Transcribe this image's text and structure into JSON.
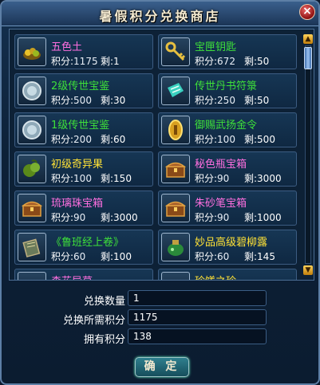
{
  "window": {
    "title": "暑假积分兑换商店",
    "close_glyph": "×"
  },
  "labels": {
    "points": "积分:",
    "remaining": "剩:"
  },
  "colors": {
    "green_name": "#3ee03a",
    "pink_name": "#ff6fe0",
    "yellow_name": "#ffe236"
  },
  "items": [
    {
      "name": "五色土",
      "color": "pink",
      "points": "1175",
      "remaining": "1",
      "icon": "five-color-soil-icon"
    },
    {
      "name": "宝匣钥匙",
      "color": "green",
      "points": "672",
      "remaining": "50",
      "icon": "treasure-key-icon"
    },
    {
      "name": "2级传世宝鉴",
      "color": "green",
      "points": "500",
      "remaining": "30",
      "icon": "mirror-icon"
    },
    {
      "name": "传世丹书符箓",
      "color": "green",
      "points": "250",
      "remaining": "50",
      "icon": "talisman-scroll-icon"
    },
    {
      "name": "1级传世宝鉴",
      "color": "green",
      "points": "200",
      "remaining": "60",
      "icon": "mirror-icon"
    },
    {
      "name": "御赐武扬金令",
      "color": "green",
      "points": "100",
      "remaining": "500",
      "icon": "gold-token-icon"
    },
    {
      "name": "初级奇异果",
      "color": "yellow",
      "points": "100",
      "remaining": "150",
      "icon": "fruit-icon"
    },
    {
      "name": "秘色瓶宝箱",
      "color": "pink",
      "points": "90",
      "remaining": "3000",
      "icon": "treasure-chest-icon"
    },
    {
      "name": "琉璃珠宝箱",
      "color": "pink",
      "points": "90",
      "remaining": "3000",
      "icon": "treasure-chest-icon"
    },
    {
      "name": "朱砂笔宝箱",
      "color": "pink",
      "points": "90",
      "remaining": "1000",
      "icon": "treasure-chest-icon"
    },
    {
      "name": "《鲁班经上卷》",
      "color": "green",
      "points": "60",
      "remaining": "100",
      "icon": "book-icon"
    },
    {
      "name": "妙品高级碧柳露",
      "color": "yellow",
      "points": "60",
      "remaining": "145",
      "icon": "potion-jar-icon"
    },
    {
      "name": "森花异草",
      "color": "pink",
      "points": "",
      "remaining": "",
      "icon": "herb-icon"
    },
    {
      "name": "珍馐之珍",
      "color": "yellow",
      "points": "",
      "remaining": "",
      "icon": "food-icon"
    }
  ],
  "form": {
    "quantity_label": "兑换数量",
    "quantity_value": "1",
    "required_label": "兑换所需积分",
    "required_value": "1175",
    "owned_label": "拥有积分",
    "owned_value": "138"
  },
  "confirm_button": "确 定",
  "scrollbar": {
    "up": "▲",
    "down": "▼"
  }
}
